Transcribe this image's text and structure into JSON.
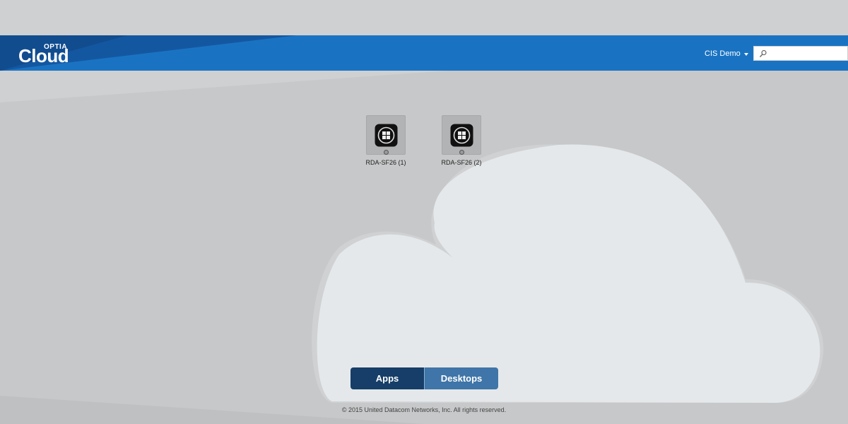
{
  "header": {
    "logo_top": "OPTIA",
    "logo_main": "Cloud",
    "user_menu_label": "CIS Demo",
    "search_placeholder": ""
  },
  "apps": [
    {
      "label": "RDA-SF26 (1)",
      "icon": "windows-icon",
      "status": "unknown"
    },
    {
      "label": "RDA-SF26 (2)",
      "icon": "windows-icon",
      "status": "unknown"
    }
  ],
  "tabs": {
    "apps_label": "Apps",
    "desktops_label": "Desktops",
    "active": "Apps"
  },
  "footer": {
    "copyright": "© 2015 United Datacom Networks, Inc. All rights reserved."
  },
  "colors": {
    "header_blue": "#1a73c2",
    "header_dark_blue": "#1457a1",
    "background": "#c9cacb",
    "cloud": "#e5e8ea",
    "tab_active": "#163e68",
    "tab_inactive": "#3f75a8"
  }
}
